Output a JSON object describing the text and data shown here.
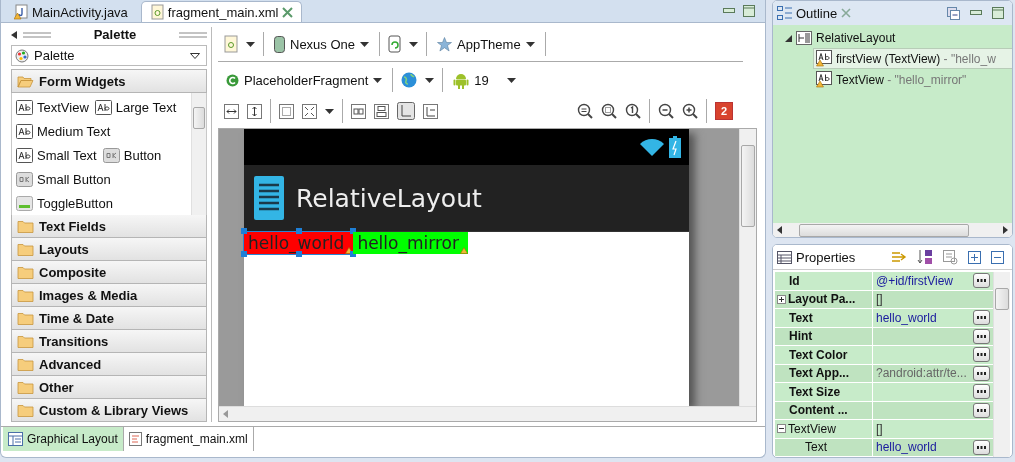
{
  "editor_tabs": [
    {
      "label": "MainActivity.java",
      "selected": false,
      "kind": "java"
    },
    {
      "label": "fragment_main.xml",
      "selected": true,
      "kind": "xml"
    }
  ],
  "palette": {
    "title": "Palette",
    "dropdown": "Palette",
    "categories": [
      {
        "label": "Form Widgets",
        "expanded": true,
        "rows": [
          {
            "items": [
              {
                "label": "TextView",
                "kind": "text"
              },
              {
                "label": "Large Text",
                "kind": "text"
              }
            ]
          },
          {
            "items": [
              {
                "label": "Medium Text",
                "kind": "text"
              }
            ]
          },
          {
            "items": [
              {
                "label": "Small Text",
                "kind": "text"
              },
              {
                "label": "Button",
                "kind": "button"
              }
            ]
          },
          {
            "items": [
              {
                "label": "Small Button",
                "kind": "button"
              }
            ]
          },
          {
            "items": [
              {
                "label": "ToggleButton",
                "kind": "toggle"
              }
            ]
          }
        ]
      },
      {
        "label": "Text Fields",
        "expanded": false
      },
      {
        "label": "Layouts",
        "expanded": false
      },
      {
        "label": "Composite",
        "expanded": false
      },
      {
        "label": "Images & Media",
        "expanded": false
      },
      {
        "label": "Time & Date",
        "expanded": false
      },
      {
        "label": "Transitions",
        "expanded": false
      },
      {
        "label": "Advanced",
        "expanded": false
      },
      {
        "label": "Other",
        "expanded": false
      },
      {
        "label": "Custom & Library Views",
        "expanded": false
      }
    ]
  },
  "toolbar": {
    "device": "Nexus One",
    "theme": "AppTheme",
    "activity": "PlaceholderFragment",
    "api": "19",
    "error_count": "2"
  },
  "preview": {
    "title": "RelativeLayout",
    "views": [
      {
        "text": "hello_world",
        "color": "#ff0000",
        "selected": true
      },
      {
        "text": "hello_mirror",
        "color": "#00ff00",
        "selected": false
      }
    ]
  },
  "bottom_tabs": [
    {
      "label": "Graphical Layout",
      "selected": true,
      "kind": "design"
    },
    {
      "label": "fragment_main.xml",
      "selected": false,
      "kind": "source"
    }
  ],
  "outline": {
    "title": "Outline",
    "root": {
      "label": "RelativeLayout",
      "expanded": true,
      "children": [
        {
          "name": "firstView (TextView)",
          "detail": " - \"hello_w",
          "selected": true
        },
        {
          "name": "TextView",
          "detail": " - \"hello_mirror\"",
          "selected": false
        }
      ]
    }
  },
  "properties": {
    "title": "Properties",
    "rows": [
      {
        "name": "Id",
        "value": "@+id/firstView",
        "kind": "property",
        "color": "#1a1a9e",
        "button": true
      },
      {
        "name": "Layout Pa...",
        "value": "[]",
        "kind": "property",
        "expanded": false,
        "button": false
      },
      {
        "name": "Text",
        "value": "hello_world",
        "kind": "property",
        "color": "#1a1a9e",
        "button": true
      },
      {
        "name": "Hint",
        "kind": "property",
        "button": true
      },
      {
        "name": "Text Color",
        "kind": "property",
        "button": true
      },
      {
        "name": "Text App...",
        "value": "?android:attr/te...",
        "kind": "property",
        "color": "#666666",
        "button": true
      },
      {
        "name": "Text Size",
        "kind": "property",
        "button": true
      },
      {
        "name": "Content ...",
        "kind": "property",
        "button": true
      },
      {
        "name": "TextView",
        "value": "[]",
        "kind": "section",
        "expanded": true,
        "button": false
      },
      {
        "name": "Text",
        "value": "hello_world",
        "kind": "nested",
        "color": "#1a1a9e",
        "button": true
      }
    ]
  }
}
